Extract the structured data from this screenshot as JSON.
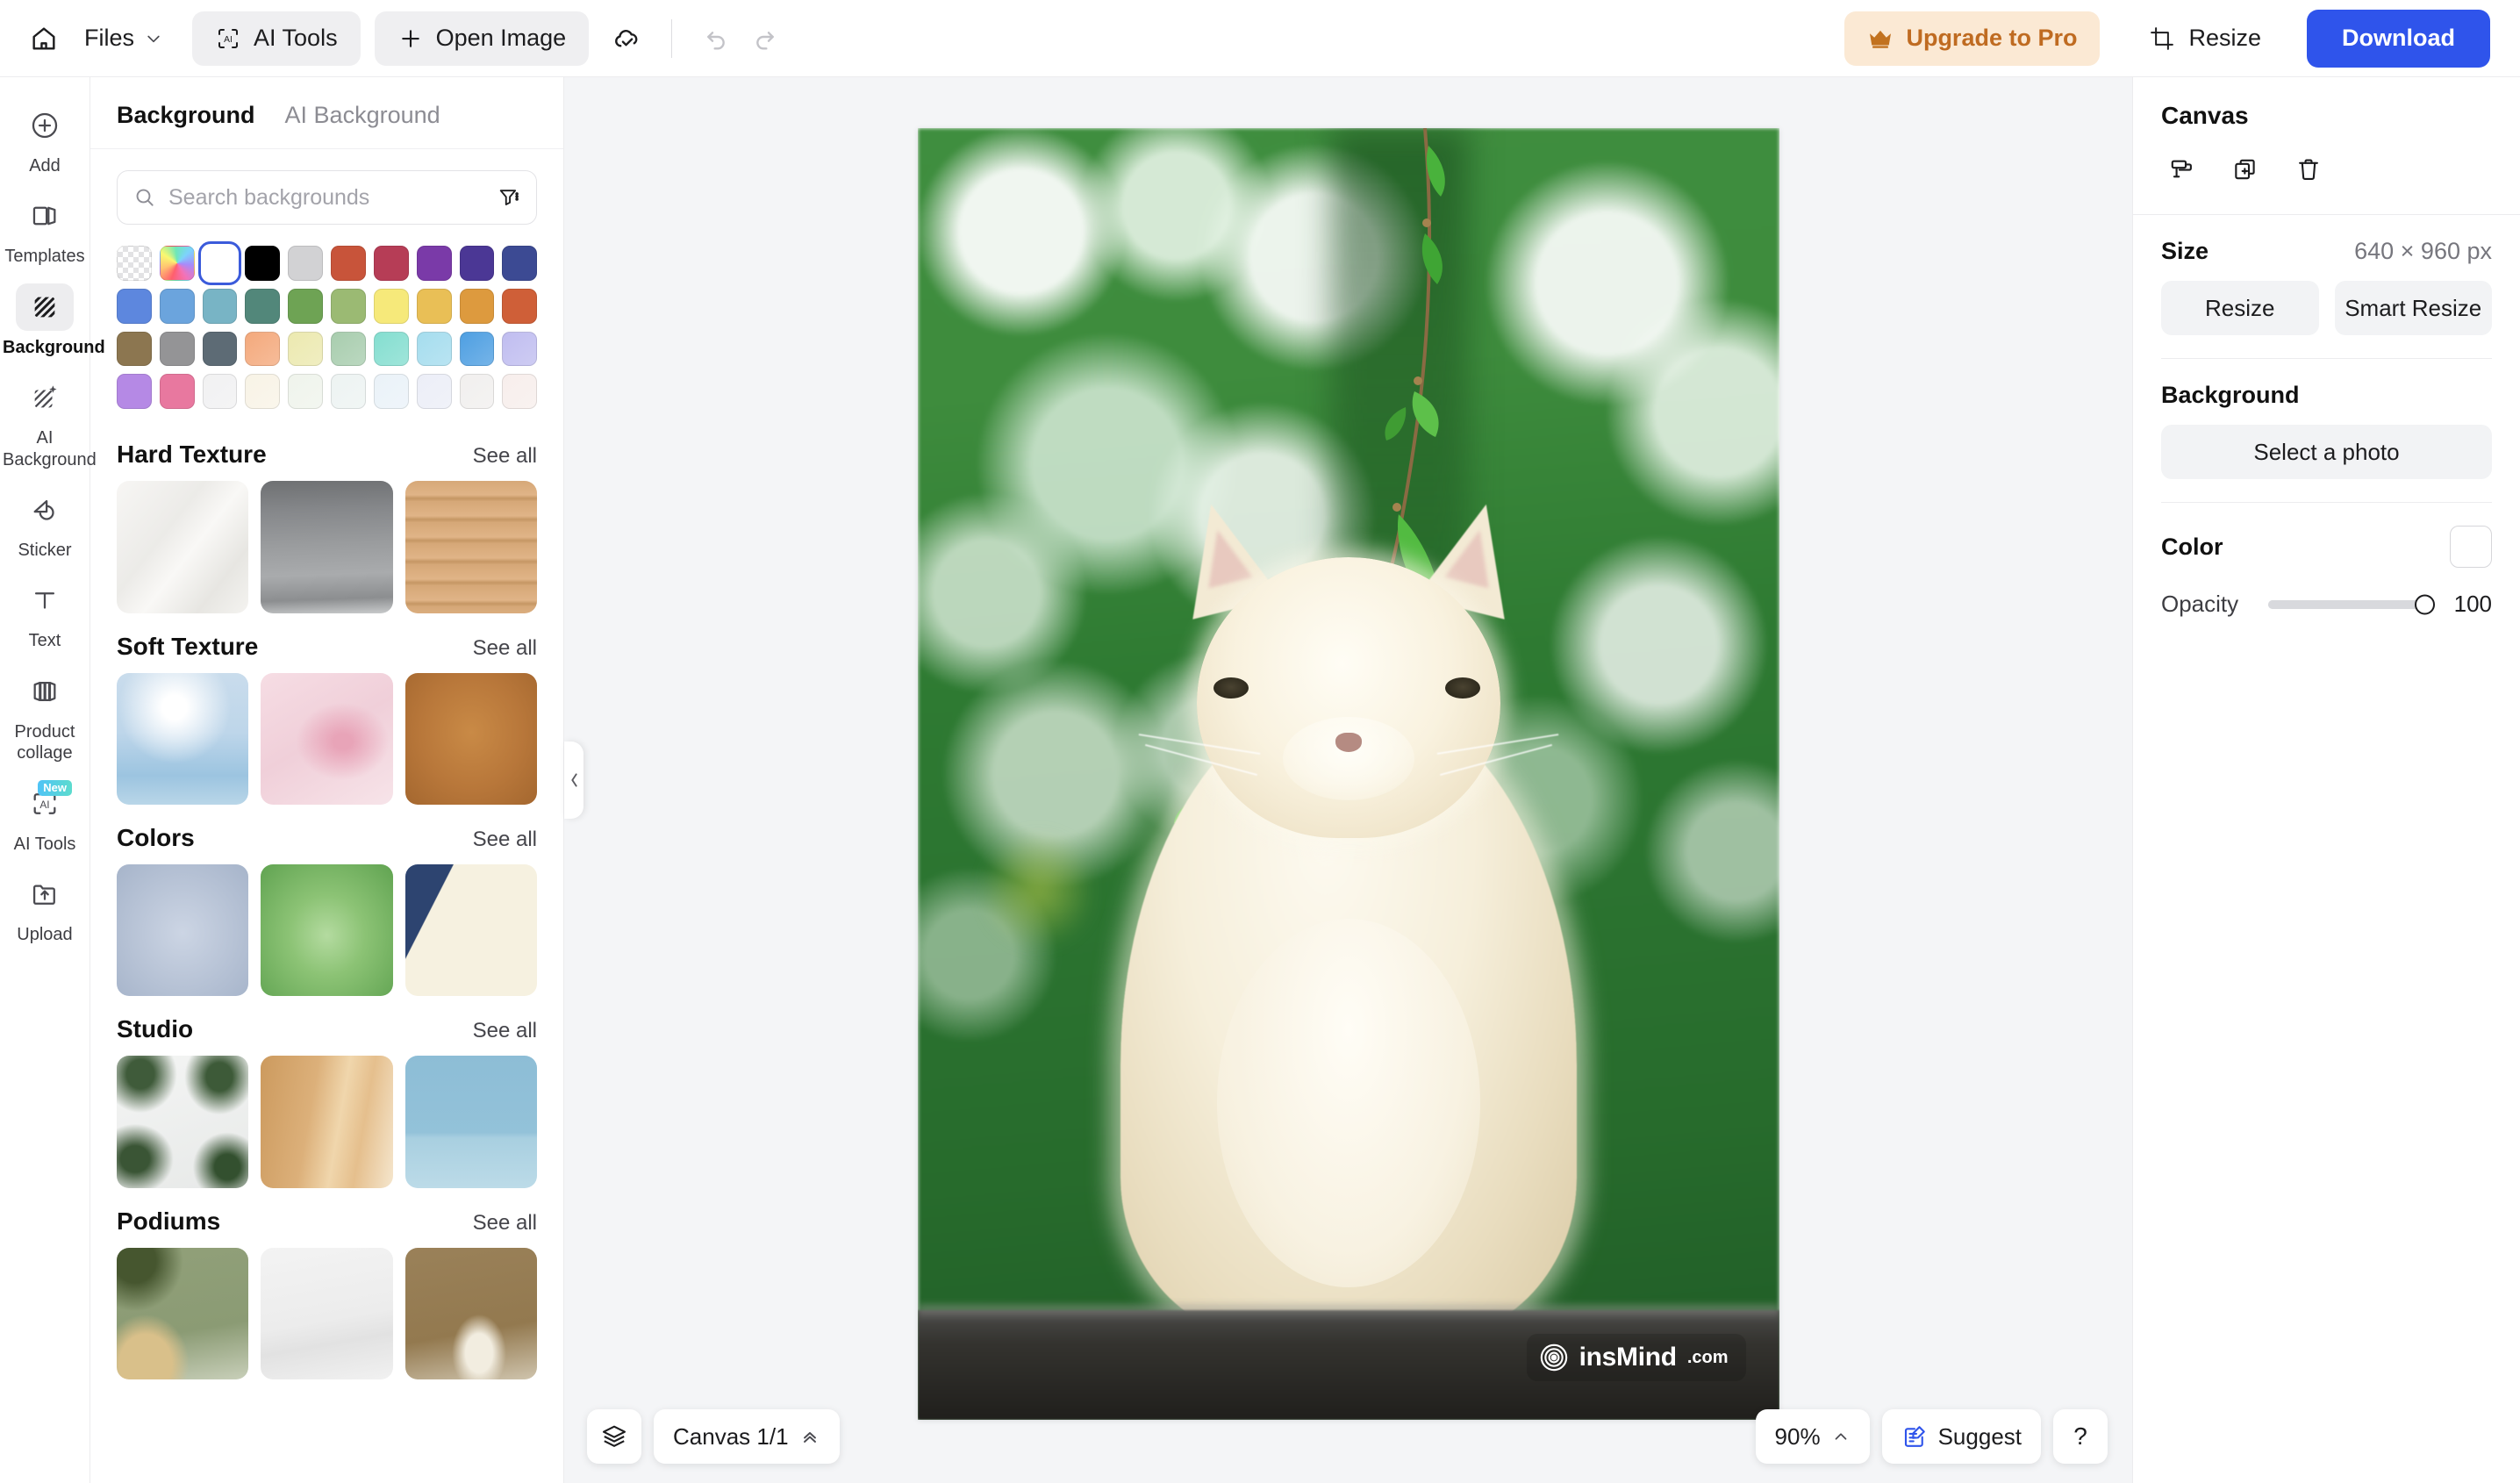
{
  "topbar": {
    "home_icon": "home-icon",
    "files_label": "Files",
    "ai_tools_label": "AI Tools",
    "open_image_label": "Open Image",
    "cloud_icon": "cloud-check-icon",
    "undo_icon": "undo-icon",
    "redo_icon": "redo-icon",
    "upgrade_label": "Upgrade to Pro",
    "crown_icon": "crown-icon",
    "resize_label": "Resize",
    "resize_icon": "crop-icon",
    "download_label": "Download",
    "accent_color": "#2f54eb",
    "upgrade_bg": "#fbe9d4",
    "upgrade_text_color": "#bf6b21"
  },
  "rail": {
    "items": [
      {
        "label": "Add",
        "icon": "plus-circle-icon",
        "active": false,
        "badge": ""
      },
      {
        "label": "Templates",
        "icon": "templates-icon",
        "active": false,
        "badge": ""
      },
      {
        "label": "Background",
        "icon": "hatch-square-icon",
        "active": true,
        "badge": ""
      },
      {
        "label": "AI Background",
        "icon": "hatch-sparkle-icon",
        "active": false,
        "badge": ""
      },
      {
        "label": "Sticker",
        "icon": "sticker-icon",
        "active": false,
        "badge": ""
      },
      {
        "label": "Text",
        "icon": "text-t-icon",
        "active": false,
        "badge": ""
      },
      {
        "label": "Product collage",
        "icon": "collage-icon",
        "active": false,
        "badge": ""
      },
      {
        "label": "AI Tools",
        "icon": "ai-scan-icon",
        "active": false,
        "badge": "New"
      },
      {
        "label": "Upload",
        "icon": "upload-folder-icon",
        "active": false,
        "badge": ""
      }
    ]
  },
  "panel": {
    "tabs": [
      {
        "label": "Background",
        "active": true
      },
      {
        "label": "AI Background",
        "active": false
      }
    ],
    "search": {
      "placeholder": "Search backgrounds",
      "value": "",
      "search_icon": "search-icon",
      "filter_icon": "filter-icon"
    },
    "swatches": [
      {
        "name": "transparent",
        "kind": "transparent",
        "selected": false
      },
      {
        "name": "color-picker",
        "kind": "rainbow",
        "selected": false
      },
      {
        "name": "white",
        "color": "#ffffff",
        "selected": true
      },
      {
        "name": "black",
        "color": "#000000",
        "selected": false
      },
      {
        "name": "light-gray",
        "color": "#d2d2d4",
        "selected": false
      },
      {
        "name": "terracotta",
        "color": "#c8543a",
        "selected": false
      },
      {
        "name": "crimson",
        "color": "#b63d56",
        "selected": false
      },
      {
        "name": "purple",
        "color": "#7a3aa8",
        "selected": false
      },
      {
        "name": "indigo",
        "color": "#4b3795",
        "selected": false
      },
      {
        "name": "navy-blue",
        "color": "#3c4a93",
        "selected": false
      },
      {
        "name": "cornflower",
        "color": "#5d87de",
        "selected": false
      },
      {
        "name": "sky-blue",
        "color": "#6ba4dd",
        "selected": false
      },
      {
        "name": "teal-blue",
        "color": "#78b4c5",
        "selected": false
      },
      {
        "name": "deep-teal",
        "color": "#52877a",
        "selected": false
      },
      {
        "name": "grass-green",
        "color": "#6ea354",
        "selected": false
      },
      {
        "name": "olive-green",
        "color": "#9bba73",
        "selected": false
      },
      {
        "name": "lemon-yellow",
        "color": "#f6e97a",
        "selected": false
      },
      {
        "name": "golden-yellow",
        "color": "#e9bf56",
        "selected": false
      },
      {
        "name": "amber-orange",
        "color": "#dd9a3e",
        "selected": false
      },
      {
        "name": "burnt-orange",
        "color": "#cf5f38",
        "selected": false
      },
      {
        "name": "khaki-brown",
        "color": "#8c7650",
        "selected": false
      },
      {
        "name": "medium-gray",
        "color": "#949496",
        "selected": false
      },
      {
        "name": "slate-gray",
        "color": "#5d6b75",
        "selected": false
      },
      {
        "name": "peach-gradient",
        "color": "#f4a97c",
        "selected": false
      },
      {
        "name": "cream-yellow-gradient",
        "color": "#ece9b0",
        "selected": false
      },
      {
        "name": "sage-gradient",
        "color": "#a8cdae",
        "selected": false
      },
      {
        "name": "mint-gradient",
        "color": "#84ded0",
        "selected": false
      },
      {
        "name": "pale-cyan-gradient",
        "color": "#a5ddee",
        "selected": false
      },
      {
        "name": "azure-gradient",
        "color": "#4e9fe2",
        "selected": false
      },
      {
        "name": "lavender-gradient",
        "color": "#c0bdf0",
        "selected": false
      },
      {
        "name": "orchid-purple",
        "color": "#b589e5",
        "selected": false
      },
      {
        "name": "rose-pink",
        "color": "#e8789f",
        "selected": false
      },
      {
        "name": "white-gray-gradient",
        "color": "#f1f1f2",
        "selected": false
      },
      {
        "name": "ivory-gradient",
        "color": "#f8f3e6",
        "selected": false
      },
      {
        "name": "pale-green-gradient",
        "color": "#eff4ec",
        "selected": false
      },
      {
        "name": "pale-aqua-gradient",
        "color": "#edf3f2",
        "selected": false
      },
      {
        "name": "pale-blue-gradient",
        "color": "#eaf2f8",
        "selected": false
      },
      {
        "name": "pale-periwinkle-gradient",
        "color": "#eceef7",
        "selected": false
      },
      {
        "name": "pale-warmgray-gradient",
        "color": "#f1efee",
        "selected": false
      },
      {
        "name": "pale-blush-gradient",
        "color": "#f7eeec",
        "selected": false
      }
    ],
    "sections": [
      {
        "title": "Hard Texture",
        "see_all": "See all",
        "thumbs": [
          {
            "name": "white-marble-texture"
          },
          {
            "name": "gray-concrete-texture"
          },
          {
            "name": "wood-plank-texture"
          }
        ]
      },
      {
        "title": "Soft Texture",
        "see_all": "See all",
        "thumbs": [
          {
            "name": "blue-water-splash-texture"
          },
          {
            "name": "pink-silk-swirl-texture"
          },
          {
            "name": "brown-leather-texture"
          }
        ]
      },
      {
        "title": "Colors",
        "see_all": "See all",
        "thumbs": [
          {
            "name": "blue-gray-radial-gradient"
          },
          {
            "name": "green-radial-gradient"
          },
          {
            "name": "navy-cream-diagonal-split"
          }
        ]
      },
      {
        "title": "Studio",
        "see_all": "See all",
        "thumbs": [
          {
            "name": "white-wall-tropical-plants"
          },
          {
            "name": "beige-silk-drapes-studio"
          },
          {
            "name": "light-blue-studio-wall"
          }
        ]
      },
      {
        "title": "Podiums",
        "see_all": "See all",
        "thumbs": [
          {
            "name": "green-wall-wooden-podium"
          },
          {
            "name": "white-minimal-podium"
          },
          {
            "name": "brown-orchid-podium"
          }
        ]
      }
    ],
    "collapse_icon": "chevron-left-icon"
  },
  "canvas": {
    "image_alt": "white fluffy cat sitting on rock with green bokeh background and hanging bamboo vine",
    "watermark_name": "insMind",
    "watermark_suffix": ".com"
  },
  "bottombar": {
    "layers_icon": "layers-icon",
    "canvas_pages_label": "Canvas 1/1",
    "canvas_chevron_icon": "chevrons-up-icon",
    "zoom_label": "90%",
    "zoom_chevron_icon": "chevron-up-icon",
    "suggest_label": "Suggest",
    "suggest_icon": "note-edit-icon",
    "help_label": "?"
  },
  "right": {
    "title": "Canvas",
    "tools": [
      {
        "name": "paint-roller-icon"
      },
      {
        "name": "duplicate-page-icon"
      },
      {
        "name": "trash-icon"
      }
    ],
    "size_label": "Size",
    "size_value": "640 × 960 px",
    "resize_label": "Resize",
    "smart_resize_label": "Smart Resize",
    "background_label": "Background",
    "select_photo_label": "Select a photo",
    "color_label": "Color",
    "color_value": "#ffffff",
    "opacity_label": "Opacity",
    "opacity_value": "100"
  }
}
